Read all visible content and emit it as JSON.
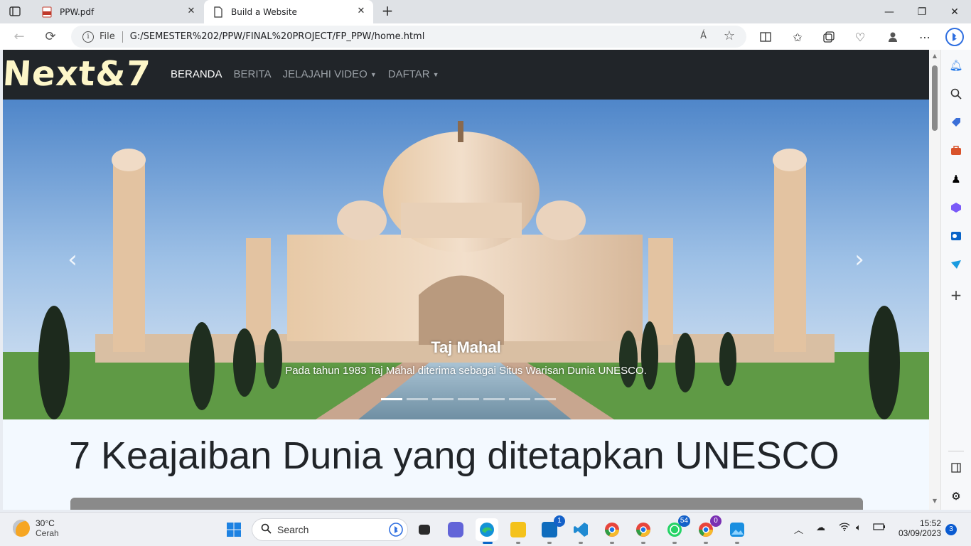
{
  "browser": {
    "tabs": [
      {
        "title": "PPW.pdf",
        "active": false
      },
      {
        "title": "Build a Website",
        "active": true
      }
    ],
    "address": {
      "scheme_label": "File",
      "url": "G:/SEMESTER%202/PPW/FINAL%20PROJECT/FP_PPW/home.html"
    },
    "readaloud_label": "Á"
  },
  "page": {
    "brand": "Next&7",
    "nav": [
      {
        "label": "BERANDA",
        "active": true
      },
      {
        "label": "BERITA",
        "active": false
      },
      {
        "label": "JELAJAHI VIDEO",
        "active": false,
        "dropdown": true
      },
      {
        "label": "DAFTAR",
        "active": false,
        "dropdown": true
      }
    ],
    "carousel": {
      "caption_title": "Taj Mahal",
      "caption_text": "Pada tahun 1983 Taj Mahal diterima sebagai Situs Warisan Dunia UNESCO.",
      "prev_icon": "‹",
      "next_icon": "›",
      "indicator_count": 7,
      "active_index": 0
    },
    "heading": "7 Keajaiban Dunia yang ditetapkan UNESCO"
  },
  "taskbar": {
    "weather": {
      "temp": "30°C",
      "condition": "Cerah"
    },
    "search_label": "Search",
    "badges": {
      "mail": "1",
      "whatsapp": "54",
      "chrome_profile": "0"
    },
    "clock": {
      "time": "15:52",
      "date": "03/09/2023"
    },
    "notifications": "3"
  },
  "colors": {
    "navbar_bg": "#212529",
    "brand": "#fdf6c8",
    "page_bg": "#f3f9ff"
  }
}
